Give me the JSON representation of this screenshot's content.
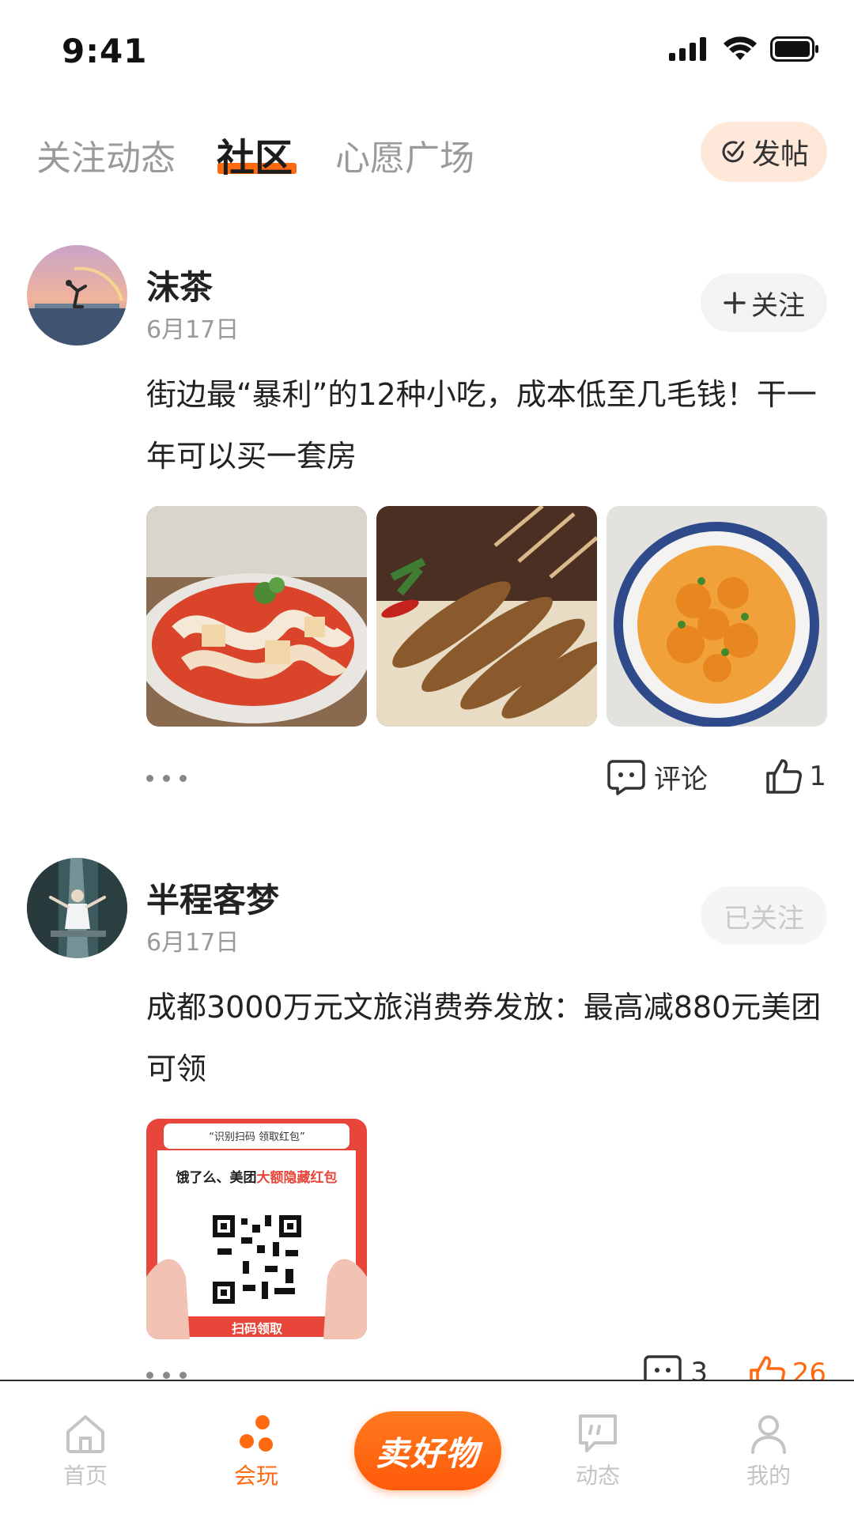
{
  "status_bar": {
    "time": "9:41"
  },
  "top_tabs": {
    "tabs": [
      {
        "label": "关注动态",
        "active": false
      },
      {
        "label": "社区",
        "active": true
      },
      {
        "label": "心愿广场",
        "active": false
      }
    ],
    "post_button_label": "发帖",
    "accent_color": "#ff6a10"
  },
  "posts": [
    {
      "user_name": "沫茶",
      "date": "6月17日",
      "follow_label": "关注",
      "followed": false,
      "text": "街边最“暴利”的12种小吃，成本低至几毛钱！干一年可以买一套房",
      "images": [
        "food-noodles-image",
        "grilled-fish-image",
        "spiral-potato-image"
      ],
      "comment_label": "评论",
      "like_count": "1"
    },
    {
      "user_name": "半程客梦",
      "date": "6月17日",
      "follow_label": "已关注",
      "followed": true,
      "text": "成都3000万元文旅消费券发放：最高减880元美团可领",
      "images": [
        "red-packet-qr-image"
      ],
      "qr_card": {
        "banner": "“识别扫码 领取红包”",
        "title_prefix": "饿了么、美团",
        "title_highlight": "大额隐藏红包",
        "button": "扫码领取"
      },
      "comment_count": "3",
      "like_count": "26"
    }
  ],
  "bottom_nav": {
    "items": [
      {
        "label": "首页",
        "icon": "home-icon",
        "active": false
      },
      {
        "label": "会玩",
        "icon": "play-dots-icon",
        "active": true
      },
      {
        "label": "动态",
        "icon": "quote-bubble-icon",
        "active": false
      },
      {
        "label": "我的",
        "icon": "user-icon",
        "active": false
      }
    ],
    "center_label": "卖好物"
  }
}
